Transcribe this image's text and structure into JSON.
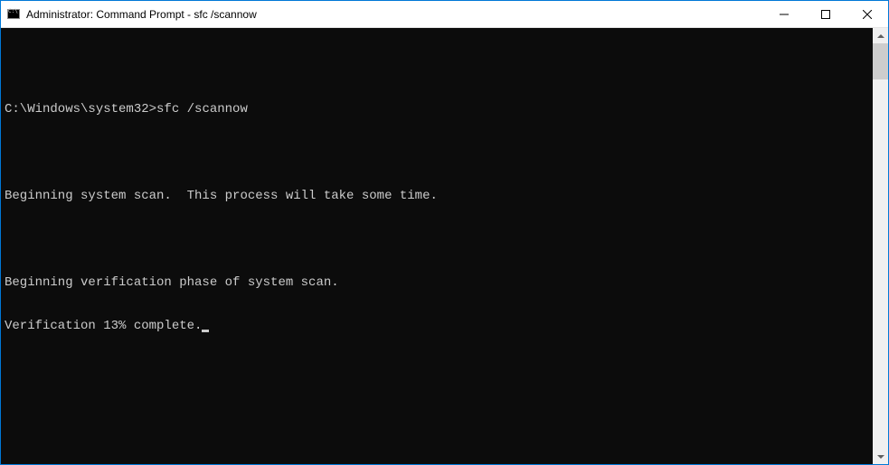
{
  "window": {
    "title": "Administrator: Command Prompt - sfc  /scannow"
  },
  "terminal": {
    "prompt": "C:\\Windows\\system32>",
    "command": "sfc /scannow",
    "lines": {
      "scan_start": "Beginning system scan.  This process will take some time.",
      "verify_phase": "Beginning verification phase of system scan.",
      "progress": "Verification 13% complete."
    }
  }
}
